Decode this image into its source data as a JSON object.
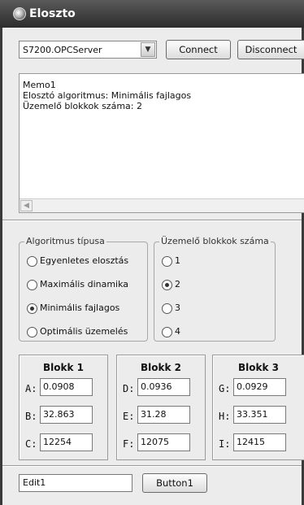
{
  "window": {
    "title": "Eloszto"
  },
  "toolbar": {
    "server_value": "S7200.OPCServer",
    "connect_label": "Connect",
    "disconnect_label": "Disconnect"
  },
  "memo": {
    "lines": [
      "Memo1",
      "Elosztó algoritmus: Minimális fajlagos",
      "Üzemelő blokkok száma: 2"
    ]
  },
  "algorithm_group": {
    "label": "Algoritmus típusa",
    "options": [
      {
        "label": "Egyenletes elosztás",
        "selected": false
      },
      {
        "label": "Maximális dinamika",
        "selected": false
      },
      {
        "label": "Minimális fajlagos",
        "selected": true
      },
      {
        "label": "Optimális üzemelés",
        "selected": false
      }
    ]
  },
  "blocks_group": {
    "label": "Üzemelő blokkok száma",
    "options": [
      {
        "label": "1",
        "selected": false
      },
      {
        "label": "2",
        "selected": true
      },
      {
        "label": "3",
        "selected": false
      },
      {
        "label": "4",
        "selected": false
      }
    ]
  },
  "panels": [
    {
      "title": "Blokk 1",
      "fields": [
        {
          "label": "A:",
          "value": "0.0908"
        },
        {
          "label": "B:",
          "value": "32.863"
        },
        {
          "label": "C:",
          "value": "12254"
        }
      ]
    },
    {
      "title": "Blokk 2",
      "fields": [
        {
          "label": "D:",
          "value": "0.0936"
        },
        {
          "label": "E:",
          "value": "31.28"
        },
        {
          "label": "F:",
          "value": "12075"
        }
      ]
    },
    {
      "title": "Blokk 3",
      "fields": [
        {
          "label": "G:",
          "value": "0.0929"
        },
        {
          "label": "H:",
          "value": "33.351"
        },
        {
          "label": "I:",
          "value": "12415"
        }
      ]
    }
  ],
  "bottom": {
    "edit_value": "Edit1",
    "button_label": "Button1"
  }
}
